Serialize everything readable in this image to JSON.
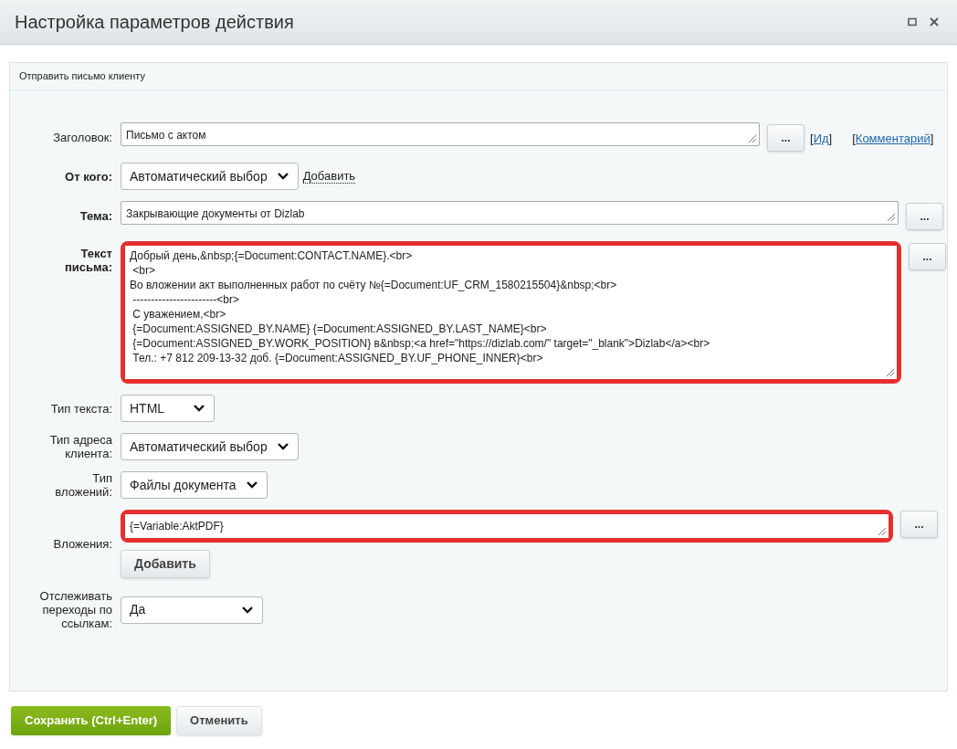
{
  "window": {
    "title": "Настройка параметров действия"
  },
  "section": {
    "title": "Отправить письмо клиенту"
  },
  "fields": [
    {
      "kind": "textarea",
      "label": "Заголовок:",
      "bold": false,
      "highlighted": false,
      "lines": [
        "Письмо с актом"
      ],
      "dots": "...",
      "links": [
        {
          "before": "[",
          "label": "Ид",
          "after": "]"
        },
        {
          "before": "[",
          "label": "Комментарий",
          "after": "]"
        }
      ]
    },
    {
      "kind": "select",
      "label": "От кого:",
      "bold": true,
      "value": "Автоматический выбор",
      "add": "Добавить"
    },
    {
      "kind": "textarea",
      "label": "Тема:",
      "bold": true,
      "highlighted": false,
      "lines": [
        "Закрывающие документы от Dizlab"
      ],
      "dots": "..."
    },
    {
      "kind": "textarea",
      "label": "Текст письма:",
      "bold": true,
      "highlighted": true,
      "lines": [
        "Добрый день,&nbsp;{=Document:CONTACT.NAME}.<br>",
        " <br>",
        "Во вложении акт выполненных работ по счёту №{=Document:UF_CRM_1580215504}&nbsp;<br>",
        " -----------------------<br>",
        " С уважением,<br>",
        " {=Document:ASSIGNED_BY.NAME} {=Document:ASSIGNED_BY.LAST_NAME}<br>",
        " {=Document:ASSIGNED_BY.WORK_POSITION} в&nbsp;<a href=\"https://dizlab.com/\" target=\"_blank\">Dizlab</a><br>",
        " Тел.: +7 812 209-13-32 доб. {=Document:ASSIGNED_BY.UF_PHONE_INNER}<br>"
      ],
      "dots": "..."
    },
    {
      "kind": "select",
      "label": "Тип текста:",
      "bold": false,
      "value": "HTML"
    },
    {
      "kind": "select",
      "label": "Тип адреса клиента:",
      "bold": false,
      "value": "Автоматический выбор"
    },
    {
      "kind": "select",
      "label": "Тип вложений:",
      "bold": false,
      "value": "Файлы документа"
    },
    {
      "kind": "attachments",
      "label": "Вложения:",
      "bold": false,
      "highlighted": true,
      "lines": [
        "{=Variable:AktPDF}"
      ],
      "dots": "...",
      "add": "Добавить"
    },
    {
      "kind": "select",
      "label": "Отслеживать переходы по ссылкам:",
      "bold": false,
      "value": "Да"
    }
  ],
  "buttons": [
    {
      "label": "Сохранить (Ctrl+Enter)",
      "primary": true
    },
    {
      "label": "Отменить",
      "primary": false
    }
  ]
}
